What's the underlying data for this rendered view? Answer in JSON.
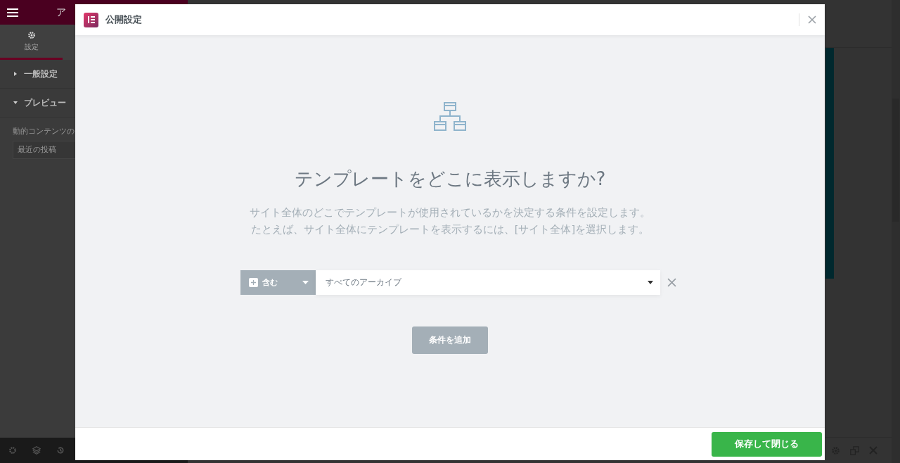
{
  "editor": {
    "header_title": "ア",
    "tabs": [
      {
        "label": "設定",
        "selected": true
      }
    ],
    "sections": [
      {
        "title": "一般設定",
        "expanded": false
      },
      {
        "title": "プレビュー",
        "expanded": true
      }
    ],
    "field_label": "動的コンテンツの",
    "field_value": "最近の投稿"
  },
  "modal": {
    "title": "公開設定",
    "heading": "テンプレートをどこに表示しますか?",
    "description": [
      "サイト全体のどこでテンプレートが使用されているかを決定する条件を設定します。",
      "たとえば、サイト全体にテンプレートを表示するには、[サイト全体]を選択します。"
    ],
    "conditions": [
      {
        "type": "含む",
        "value": "すべてのアーカイブ"
      }
    ],
    "add_button": "条件を追加",
    "save_button": "保存して閉じる"
  }
}
